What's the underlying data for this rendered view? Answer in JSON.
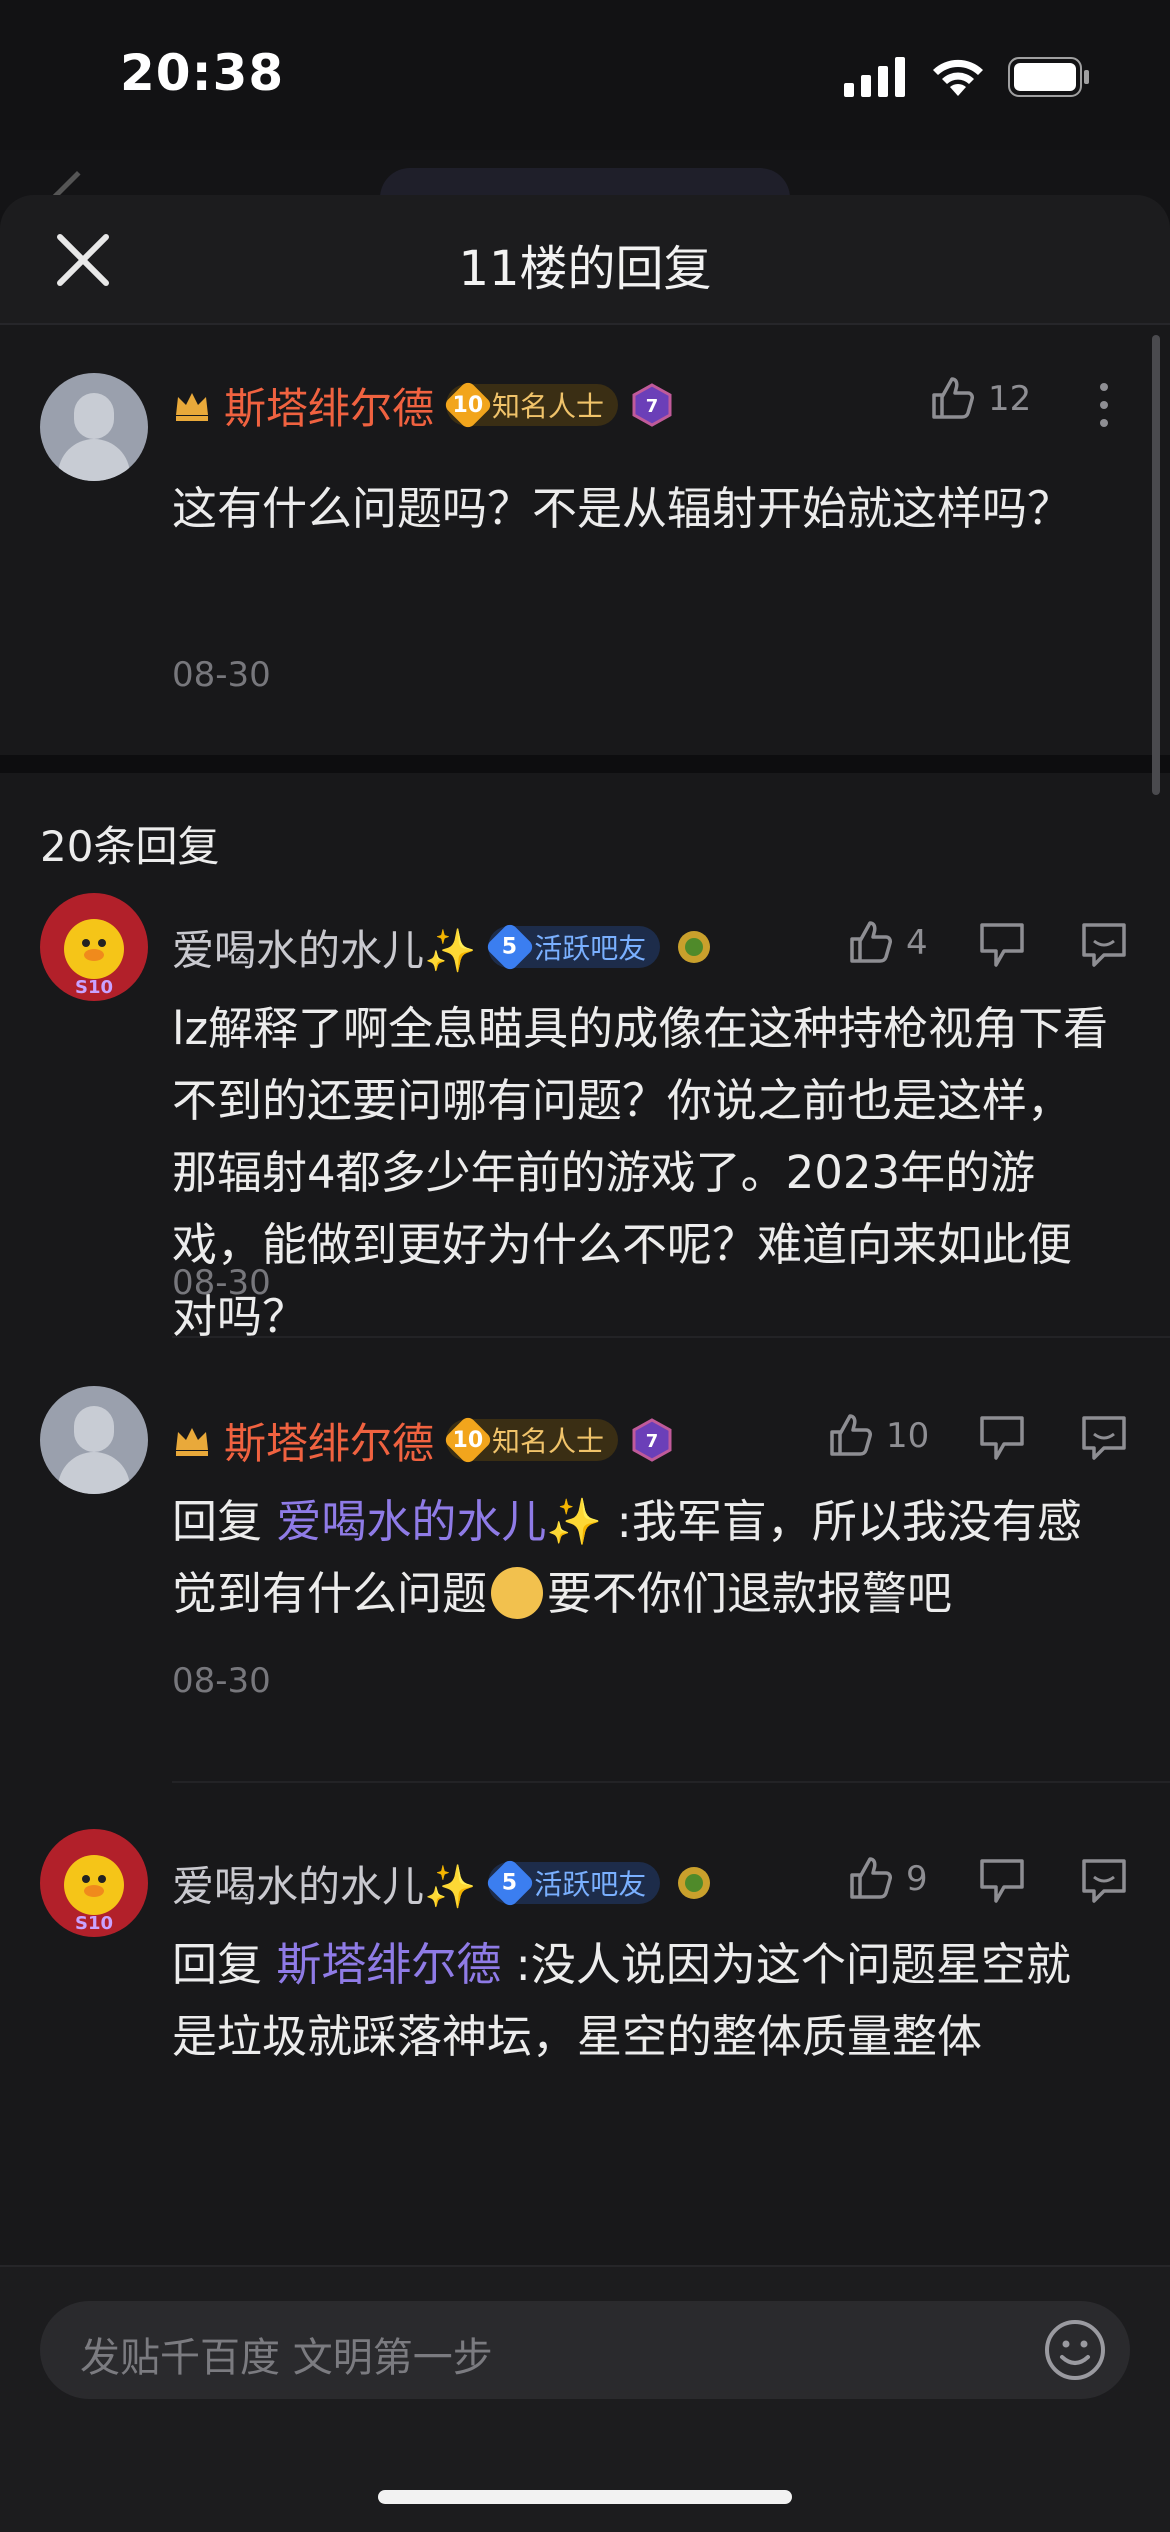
{
  "status_bar": {
    "time": "20:38"
  },
  "sheet": {
    "title": "11楼的回复"
  },
  "main_post": {
    "author": "斯塔绯尔德",
    "level": "10",
    "badge": "知名人士",
    "medal_level": "7",
    "likes": "12",
    "content": "这有什么问题吗？不是从辐射开始就这样吗？",
    "date": "08-30"
  },
  "replies_header": "20条回复",
  "replies": [
    {
      "author": "爱喝水的水儿✨",
      "level": "5",
      "badge": "活跃吧友",
      "avatar_tag": "S10",
      "likes": "4",
      "content": "lz解释了啊全息瞄具的成像在这种持枪视角下看不到的还要问哪有问题？你说之前也是这样，那辐射4都多少年前的游戏了。2023年的游戏，能做到更好为什么不呢？难道向来如此便对吗？",
      "date": "08-30"
    },
    {
      "author": "斯塔绯尔德",
      "level": "10",
      "badge": "知名人士",
      "medal_level": "7",
      "likes": "10",
      "reply_prefix": "回复",
      "mention": "爱喝水的水儿✨",
      "content_before_emoji": ":我军盲，所以我没有感觉到有什么问题",
      "content_after_emoji": "要不你们退款报警吧",
      "date": "08-30"
    },
    {
      "author": "爱喝水的水儿✨",
      "level": "5",
      "badge": "活跃吧友",
      "avatar_tag": "S10",
      "likes": "9",
      "reply_prefix": "回复",
      "mention": "斯塔绯尔德",
      "content": ":没人说因为这个问题星空就是垃圾就踩落神坛，星空的整体质量整体"
    }
  ],
  "input": {
    "placeholder": "发贴千百度 文明第一步"
  }
}
